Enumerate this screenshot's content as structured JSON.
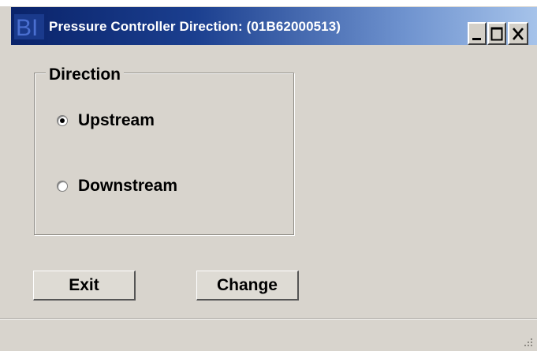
{
  "window": {
    "title": "Pressure Controller Direction: (01B62000513)",
    "icon": "bi-logo-icon"
  },
  "title_controls": {
    "minimize": "minimize-icon",
    "maximize": "maximize-icon",
    "close": "close-icon"
  },
  "direction_group": {
    "legend": "Direction",
    "options": [
      {
        "label": "Upstream",
        "selected": true
      },
      {
        "label": "Downstream",
        "selected": false
      }
    ]
  },
  "buttons": {
    "exit_label": "Exit",
    "change_label": "Change"
  },
  "colors": {
    "titlebar_start": "#0a236a",
    "titlebar_end": "#a6c3ea",
    "window_bg": "#d8d4cd"
  }
}
